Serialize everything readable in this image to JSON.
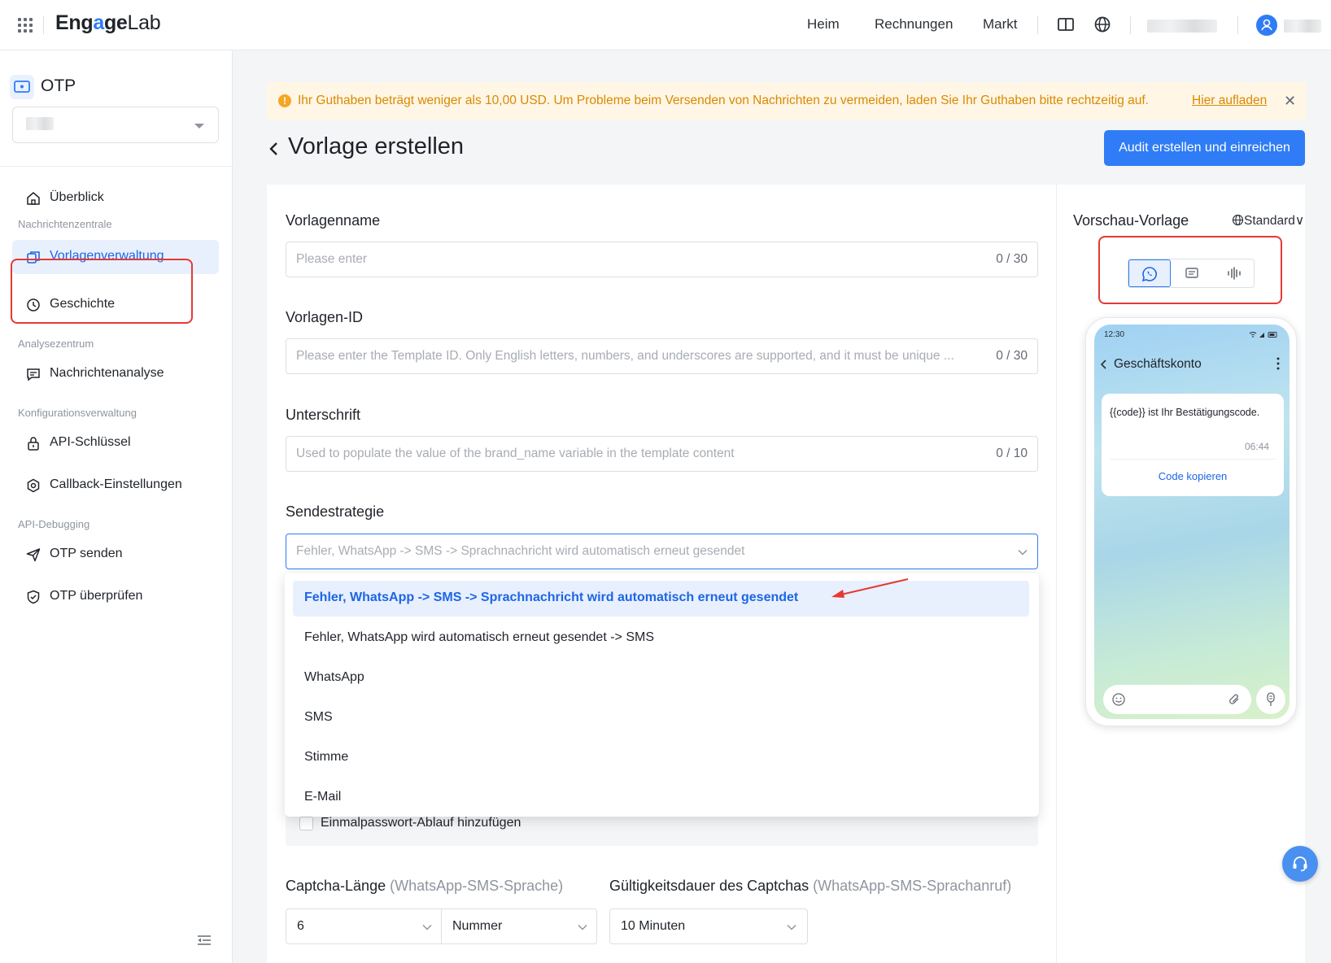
{
  "topbar": {
    "logo": {
      "part1": "Eng",
      "part2": "a",
      "part3": "ge",
      "part4": "Lab"
    },
    "nav": [
      "Heim",
      "Rechnungen",
      "Markt"
    ]
  },
  "sidebar": {
    "app_title": "OTP",
    "groups": {
      "messages": "Nachrichtenzentrale",
      "analysis": "Analysezentrum",
      "config": "Konfigurationsverwaltung",
      "debug": "API-Debugging"
    },
    "items": {
      "overview": "Überblick",
      "templates": "Vorlagenverwaltung",
      "history": "Geschichte",
      "msg_analysis": "Nachrichtenanalyse",
      "api_keys": "API-Schlüssel",
      "callback": "Callback-Einstellungen",
      "send_otp": "OTP senden",
      "verify_otp": "OTP überprüfen"
    }
  },
  "alert": {
    "text": "Ihr Guthaben beträgt weniger als 10,00 USD. Um Probleme beim Versenden von Nachrichten zu vermeiden, laden Sie Ihr Guthaben bitte rechtzeitig auf.",
    "link": "Hier aufladen",
    "close": "✕"
  },
  "page": {
    "title": "Vorlage erstellen",
    "submit_button": "Audit erstellen und einreichen"
  },
  "form": {
    "name_label": "Vorlagenname",
    "name_placeholder": "Please enter",
    "name_count": "0 / 30",
    "id_label": "Vorlagen-ID",
    "id_placeholder": "Please enter the Template ID. Only English letters, numbers, and underscores are supported, and it must be unique ...",
    "id_count": "0 / 30",
    "signature_label": "Unterschrift",
    "signature_placeholder": "Used to populate the value of the brand_name variable in the template content",
    "signature_count": "0 / 10",
    "strategy_label": "Sendestrategie",
    "strategy_value": "Fehler, WhatsApp -> SMS -> Sprachnachricht wird automatisch erneut gesendet",
    "strategy_options": [
      "Fehler, WhatsApp -> SMS -> Sprachnachricht wird automatisch erneut gesendet",
      "Fehler, WhatsApp wird automatisch erneut gesendet -> SMS",
      "WhatsApp",
      "SMS",
      "Stimme",
      "E-Mail"
    ],
    "expiry_checkbox": "Einmalpasswort-Ablauf hinzufügen",
    "captcha_length_label": "Captcha-Länge",
    "captcha_length_hint": "(WhatsApp-SMS-Sprache)",
    "validity_label": "Gültigkeitsdauer des Captchas",
    "validity_hint": "(WhatsApp-SMS-Sprachanruf)",
    "length_value": "6",
    "type_value": "Nummer",
    "validity_value": "10 Minuten"
  },
  "preview": {
    "title": "Vorschau-Vorlage",
    "language": "Standard",
    "time": "12:30",
    "contact": "Geschäftskonto",
    "message": "{{code}} ist Ihr Bestätigungscode.",
    "msg_time": "06:44",
    "copy_button": "Code kopieren"
  },
  "colors": {
    "accent": "#2f7cf6",
    "warning_bg": "#fff6e6",
    "warning_text": "#d98a00",
    "highlight": "#e53935"
  }
}
